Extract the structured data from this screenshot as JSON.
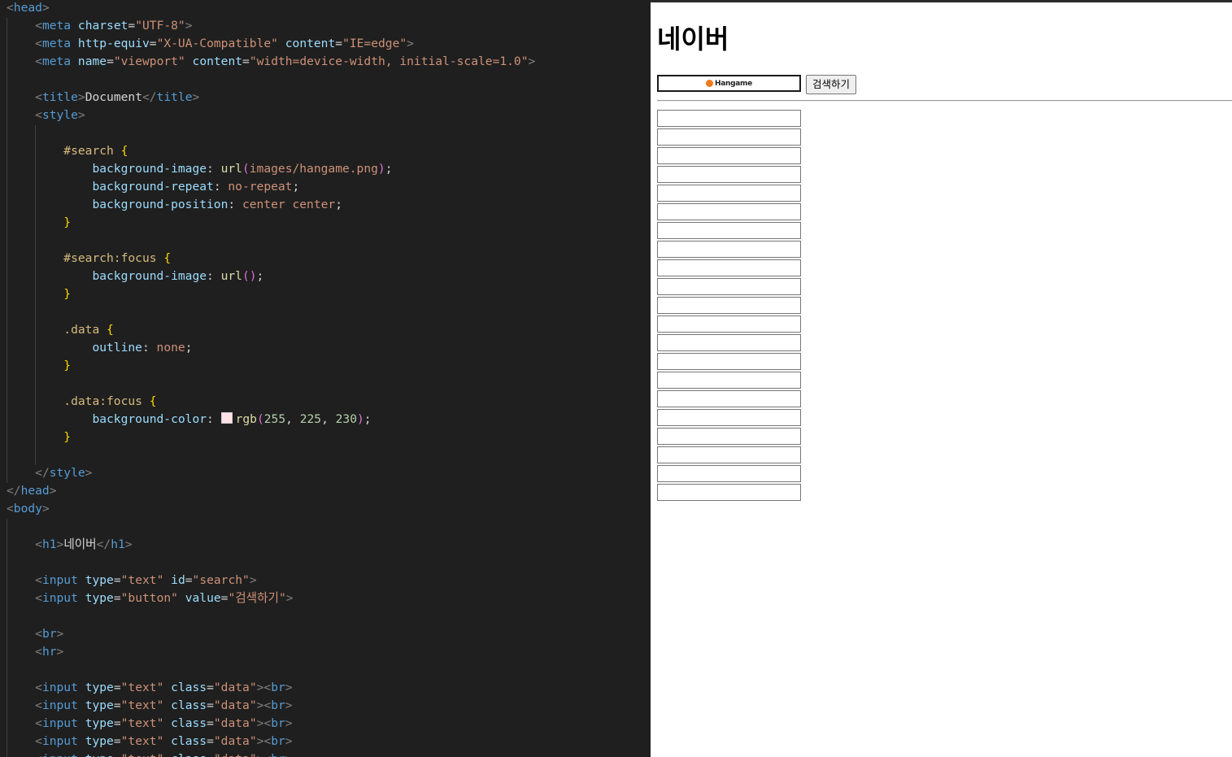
{
  "editor": {
    "lines": [
      [
        [
          "tk-tag",
          "<"
        ],
        [
          "tk-el",
          "head"
        ],
        [
          "tk-tag",
          ">"
        ]
      ],
      [
        [
          "tk-txt",
          "    "
        ],
        [
          "tk-tag",
          "<"
        ],
        [
          "tk-el",
          "meta"
        ],
        [
          "tk-txt",
          " "
        ],
        [
          "tk-attr",
          "charset"
        ],
        [
          "tk-punct",
          "="
        ],
        [
          "tk-str",
          "\"UTF-8\""
        ],
        [
          "tk-tag",
          ">"
        ]
      ],
      [
        [
          "tk-txt",
          "    "
        ],
        [
          "tk-tag",
          "<"
        ],
        [
          "tk-el",
          "meta"
        ],
        [
          "tk-txt",
          " "
        ],
        [
          "tk-attr",
          "http-equiv"
        ],
        [
          "tk-punct",
          "="
        ],
        [
          "tk-str",
          "\"X-UA-Compatible\""
        ],
        [
          "tk-txt",
          " "
        ],
        [
          "tk-attr",
          "content"
        ],
        [
          "tk-punct",
          "="
        ],
        [
          "tk-str",
          "\"IE=edge\""
        ],
        [
          "tk-tag",
          ">"
        ]
      ],
      [
        [
          "tk-txt",
          "    "
        ],
        [
          "tk-tag",
          "<"
        ],
        [
          "tk-el",
          "meta"
        ],
        [
          "tk-txt",
          " "
        ],
        [
          "tk-attr",
          "name"
        ],
        [
          "tk-punct",
          "="
        ],
        [
          "tk-str",
          "\"viewport\""
        ],
        [
          "tk-txt",
          " "
        ],
        [
          "tk-attr",
          "content"
        ],
        [
          "tk-punct",
          "="
        ],
        [
          "tk-str",
          "\"width=device-width, initial-scale=1.0\""
        ],
        [
          "tk-tag",
          ">"
        ]
      ],
      [],
      [
        [
          "tk-txt",
          "    "
        ],
        [
          "tk-tag",
          "<"
        ],
        [
          "tk-el",
          "title"
        ],
        [
          "tk-tag",
          ">"
        ],
        [
          "tk-txt",
          "Document"
        ],
        [
          "tk-tag",
          "</"
        ],
        [
          "tk-el",
          "title"
        ],
        [
          "tk-tag",
          ">"
        ]
      ],
      [
        [
          "tk-txt",
          "    "
        ],
        [
          "tk-tag",
          "<"
        ],
        [
          "tk-el",
          "style"
        ],
        [
          "tk-tag",
          ">"
        ]
      ],
      [],
      [
        [
          "tk-txt",
          "        "
        ],
        [
          "tk-sel",
          "#search"
        ],
        [
          "tk-txt",
          " "
        ],
        [
          "tk-brace",
          "{"
        ]
      ],
      [
        [
          "tk-txt",
          "            "
        ],
        [
          "tk-prop",
          "background-image"
        ],
        [
          "tk-punct",
          ": "
        ],
        [
          "tk-fn",
          "url"
        ],
        [
          "tk-paren",
          "("
        ],
        [
          "tk-val",
          "images/hangame.png"
        ],
        [
          "tk-paren",
          ")"
        ],
        [
          "tk-punct",
          ";"
        ]
      ],
      [
        [
          "tk-txt",
          "            "
        ],
        [
          "tk-prop",
          "background-repeat"
        ],
        [
          "tk-punct",
          ": "
        ],
        [
          "tk-val",
          "no-repeat"
        ],
        [
          "tk-punct",
          ";"
        ]
      ],
      [
        [
          "tk-txt",
          "            "
        ],
        [
          "tk-prop",
          "background-position"
        ],
        [
          "tk-punct",
          ": "
        ],
        [
          "tk-val",
          "center center"
        ],
        [
          "tk-punct",
          ";"
        ]
      ],
      [
        [
          "tk-txt",
          "        "
        ],
        [
          "tk-brace",
          "}"
        ]
      ],
      [],
      [
        [
          "tk-txt",
          "        "
        ],
        [
          "tk-sel",
          "#search:focus"
        ],
        [
          "tk-txt",
          " "
        ],
        [
          "tk-brace",
          "{"
        ]
      ],
      [
        [
          "tk-txt",
          "            "
        ],
        [
          "tk-prop",
          "background-image"
        ],
        [
          "tk-punct",
          ": "
        ],
        [
          "tk-fn",
          "url"
        ],
        [
          "tk-paren",
          "()"
        ],
        [
          "tk-punct",
          ";"
        ]
      ],
      [
        [
          "tk-txt",
          "        "
        ],
        [
          "tk-brace",
          "}"
        ]
      ],
      [],
      [
        [
          "tk-txt",
          "        "
        ],
        [
          "tk-sel",
          ".data"
        ],
        [
          "tk-txt",
          " "
        ],
        [
          "tk-brace",
          "{"
        ]
      ],
      [
        [
          "tk-txt",
          "            "
        ],
        [
          "tk-prop",
          "outline"
        ],
        [
          "tk-punct",
          ": "
        ],
        [
          "tk-val",
          "none"
        ],
        [
          "tk-punct",
          ";"
        ]
      ],
      [
        [
          "tk-txt",
          "        "
        ],
        [
          "tk-brace",
          "}"
        ]
      ],
      [],
      [
        [
          "tk-txt",
          "        "
        ],
        [
          "tk-sel",
          ".data:focus"
        ],
        [
          "tk-txt",
          " "
        ],
        [
          "tk-brace",
          "{"
        ]
      ],
      [
        [
          "tk-txt",
          "            "
        ],
        [
          "tk-prop",
          "background-color"
        ],
        [
          "tk-punct",
          ": "
        ],
        [
          "swatch",
          ""
        ],
        [
          "tk-fn",
          "rgb"
        ],
        [
          "tk-paren",
          "("
        ],
        [
          "tk-num",
          "255"
        ],
        [
          "tk-punct",
          ", "
        ],
        [
          "tk-num",
          "225"
        ],
        [
          "tk-punct",
          ", "
        ],
        [
          "tk-num",
          "230"
        ],
        [
          "tk-paren",
          ")"
        ],
        [
          "tk-punct",
          ";"
        ]
      ],
      [
        [
          "tk-txt",
          "        "
        ],
        [
          "tk-brace",
          "}"
        ]
      ],
      [],
      [
        [
          "tk-txt",
          "    "
        ],
        [
          "tk-tag",
          "</"
        ],
        [
          "tk-el",
          "style"
        ],
        [
          "tk-tag",
          ">"
        ]
      ],
      [
        [
          "tk-tag",
          "</"
        ],
        [
          "tk-el",
          "head"
        ],
        [
          "tk-tag",
          ">"
        ]
      ],
      [
        [
          "tk-tag",
          "<"
        ],
        [
          "tk-el",
          "body"
        ],
        [
          "tk-tag",
          ">"
        ]
      ],
      [],
      [
        [
          "tk-txt",
          "    "
        ],
        [
          "tk-tag",
          "<"
        ],
        [
          "tk-el",
          "h1"
        ],
        [
          "tk-tag",
          ">"
        ],
        [
          "tk-txt",
          "네이버"
        ],
        [
          "tk-tag",
          "</"
        ],
        [
          "tk-el",
          "h1"
        ],
        [
          "tk-tag",
          ">"
        ]
      ],
      [],
      [
        [
          "tk-txt",
          "    "
        ],
        [
          "tk-tag",
          "<"
        ],
        [
          "tk-el",
          "input"
        ],
        [
          "tk-txt",
          " "
        ],
        [
          "tk-attr",
          "type"
        ],
        [
          "tk-punct",
          "="
        ],
        [
          "tk-str",
          "\"text\""
        ],
        [
          "tk-txt",
          " "
        ],
        [
          "tk-attr",
          "id"
        ],
        [
          "tk-punct",
          "="
        ],
        [
          "tk-str",
          "\"search\""
        ],
        [
          "tk-tag",
          ">"
        ]
      ],
      [
        [
          "tk-txt",
          "    "
        ],
        [
          "tk-tag",
          "<"
        ],
        [
          "tk-el",
          "input"
        ],
        [
          "tk-txt",
          " "
        ],
        [
          "tk-attr",
          "type"
        ],
        [
          "tk-punct",
          "="
        ],
        [
          "tk-str",
          "\"button\""
        ],
        [
          "tk-txt",
          " "
        ],
        [
          "tk-attr",
          "value"
        ],
        [
          "tk-punct",
          "="
        ],
        [
          "tk-str",
          "\"검색하기\""
        ],
        [
          "tk-tag",
          ">"
        ]
      ],
      [],
      [
        [
          "tk-txt",
          "    "
        ],
        [
          "tk-tag",
          "<"
        ],
        [
          "tk-el",
          "br"
        ],
        [
          "tk-tag",
          ">"
        ]
      ],
      [
        [
          "tk-txt",
          "    "
        ],
        [
          "tk-tag",
          "<"
        ],
        [
          "tk-el",
          "hr"
        ],
        [
          "tk-tag",
          ">"
        ]
      ],
      [],
      [
        [
          "tk-txt",
          "    "
        ],
        [
          "tk-tag",
          "<"
        ],
        [
          "tk-el",
          "input"
        ],
        [
          "tk-txt",
          " "
        ],
        [
          "tk-attr",
          "type"
        ],
        [
          "tk-punct",
          "="
        ],
        [
          "tk-str",
          "\"text\""
        ],
        [
          "tk-txt",
          " "
        ],
        [
          "tk-attr",
          "class"
        ],
        [
          "tk-punct",
          "="
        ],
        [
          "tk-str",
          "\"data\""
        ],
        [
          "tk-tag",
          "><"
        ],
        [
          "tk-el",
          "br"
        ],
        [
          "tk-tag",
          ">"
        ]
      ],
      [
        [
          "tk-txt",
          "    "
        ],
        [
          "tk-tag",
          "<"
        ],
        [
          "tk-el",
          "input"
        ],
        [
          "tk-txt",
          " "
        ],
        [
          "tk-attr",
          "type"
        ],
        [
          "tk-punct",
          "="
        ],
        [
          "tk-str",
          "\"text\""
        ],
        [
          "tk-txt",
          " "
        ],
        [
          "tk-attr",
          "class"
        ],
        [
          "tk-punct",
          "="
        ],
        [
          "tk-str",
          "\"data\""
        ],
        [
          "tk-tag",
          "><"
        ],
        [
          "tk-el",
          "br"
        ],
        [
          "tk-tag",
          ">"
        ]
      ],
      [
        [
          "tk-txt",
          "    "
        ],
        [
          "tk-tag",
          "<"
        ],
        [
          "tk-el",
          "input"
        ],
        [
          "tk-txt",
          " "
        ],
        [
          "tk-attr",
          "type"
        ],
        [
          "tk-punct",
          "="
        ],
        [
          "tk-str",
          "\"text\""
        ],
        [
          "tk-txt",
          " "
        ],
        [
          "tk-attr",
          "class"
        ],
        [
          "tk-punct",
          "="
        ],
        [
          "tk-str",
          "\"data\""
        ],
        [
          "tk-tag",
          "><"
        ],
        [
          "tk-el",
          "br"
        ],
        [
          "tk-tag",
          ">"
        ]
      ],
      [
        [
          "tk-txt",
          "    "
        ],
        [
          "tk-tag",
          "<"
        ],
        [
          "tk-el",
          "input"
        ],
        [
          "tk-txt",
          " "
        ],
        [
          "tk-attr",
          "type"
        ],
        [
          "tk-punct",
          "="
        ],
        [
          "tk-str",
          "\"text\""
        ],
        [
          "tk-txt",
          " "
        ],
        [
          "tk-attr",
          "class"
        ],
        [
          "tk-punct",
          "="
        ],
        [
          "tk-str",
          "\"data\""
        ],
        [
          "tk-tag",
          "><"
        ],
        [
          "tk-el",
          "br"
        ],
        [
          "tk-tag",
          ">"
        ]
      ],
      [
        [
          "tk-txt",
          "    "
        ],
        [
          "tk-tag",
          "<"
        ],
        [
          "tk-el",
          "input"
        ],
        [
          "tk-txt",
          " "
        ],
        [
          "tk-attr",
          "type"
        ],
        [
          "tk-punct",
          "="
        ],
        [
          "tk-str",
          "\"text\""
        ],
        [
          "tk-txt",
          " "
        ],
        [
          "tk-attr",
          "class"
        ],
        [
          "tk-punct",
          "="
        ],
        [
          "tk-str",
          "\"data\""
        ],
        [
          "tk-tag",
          "><"
        ],
        [
          "tk-el",
          "br"
        ],
        [
          "tk-tag",
          ">"
        ]
      ]
    ],
    "swatch_color": "#ffe1e6"
  },
  "preview": {
    "heading": "네이버",
    "search_logo_text": "Hangame",
    "search_logo_icon": "hangame-logo-icon",
    "search_button_label": "검색하기",
    "data_input_count": 21
  }
}
